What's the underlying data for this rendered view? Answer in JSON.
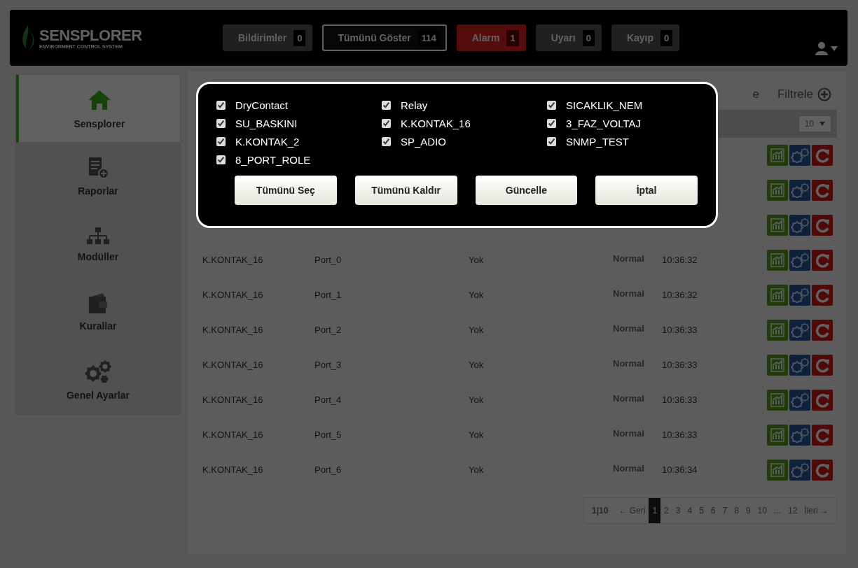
{
  "header": {
    "logo": {
      "name": "SENSPLORER",
      "tagline": "ENVIRONMENT CONTROL SYSTEM"
    },
    "filters": [
      {
        "label": "Bildirimler",
        "count": "0",
        "kind": "plain",
        "selected": false
      },
      {
        "label": "Tümünü Göster",
        "count": "114",
        "kind": "plain",
        "selected": true
      },
      {
        "label": "Alarm",
        "count": "1",
        "kind": "alarm",
        "selected": false
      },
      {
        "label": "Uyarı",
        "count": "0",
        "kind": "plain",
        "selected": false
      },
      {
        "label": "Kayıp",
        "count": "0",
        "kind": "plain",
        "selected": false
      }
    ]
  },
  "sidebar": {
    "items": [
      {
        "label": "Sensplorer",
        "selected": true
      },
      {
        "label": "Raporlar",
        "selected": false
      },
      {
        "label": "Modüller",
        "selected": false
      },
      {
        "label": "Kurallar",
        "selected": false
      },
      {
        "label": "Genel Ayarlar",
        "selected": false
      }
    ]
  },
  "panel": {
    "heading_tail": "e",
    "filter_label": "Filtrele",
    "page_size": "10",
    "rows": [
      {},
      {},
      {},
      {
        "cells": [
          "K.KONTAK_16",
          "Port_0",
          "Yok",
          "Normal",
          "10:36:32"
        ]
      },
      {
        "cells": [
          "K.KONTAK_16",
          "Port_1",
          "Yok",
          "Normal",
          "10:36:32"
        ]
      },
      {
        "cells": [
          "K.KONTAK_16",
          "Port_2",
          "Yok",
          "Normal",
          "10:36:33"
        ]
      },
      {
        "cells": [
          "K.KONTAK_16",
          "Port_3",
          "Yok",
          "Normal",
          "10:36:33"
        ]
      },
      {
        "cells": [
          "K.KONTAK_16",
          "Port_4",
          "Yok",
          "Normal",
          "10:36:33"
        ]
      },
      {
        "cells": [
          "K.KONTAK_16",
          "Port_5",
          "Yok",
          "Normal",
          "10:36:33"
        ]
      },
      {
        "cells": [
          "K.KONTAK_16",
          "Port_6",
          "Yok",
          "Normal",
          "10:36:34"
        ]
      }
    ],
    "pagination": {
      "info": "1|10",
      "prev": {
        "arrow": "←",
        "label": "Geri"
      },
      "pages": [
        {
          "label": "1",
          "selected": true
        },
        {
          "label": "2",
          "selected": false
        },
        {
          "label": "3",
          "selected": false
        },
        {
          "label": "4",
          "selected": false
        },
        {
          "label": "5",
          "selected": false
        },
        {
          "label": "6",
          "selected": false
        },
        {
          "label": "7",
          "selected": false
        },
        {
          "label": "8",
          "selected": false
        },
        {
          "label": "9",
          "selected": false
        },
        {
          "label": "10",
          "selected": false
        },
        {
          "label": "...",
          "selected": false
        },
        {
          "label": "12",
          "selected": false
        }
      ],
      "next": {
        "label": "İleri",
        "arrow": "→"
      }
    }
  },
  "modal": {
    "options": [
      {
        "label": "DryContact",
        "checked": true
      },
      {
        "label": "Relay",
        "checked": true
      },
      {
        "label": "SICAKLIK_NEM",
        "checked": true
      },
      {
        "label": "SU_BASKINI",
        "checked": true
      },
      {
        "label": "K.KONTAK_16",
        "checked": true
      },
      {
        "label": "3_FAZ_VOLTAJ",
        "checked": true
      },
      {
        "label": "K.KONTAK_2",
        "checked": true
      },
      {
        "label": "SP_ADIO",
        "checked": true
      },
      {
        "label": "SNMP_TEST",
        "checked": true
      },
      {
        "label": "8_PORT_ROLE",
        "checked": true
      }
    ],
    "buttons": [
      "Tümünü Seç",
      "Tümünü Kaldır",
      "Güncelle",
      "İptal"
    ]
  }
}
